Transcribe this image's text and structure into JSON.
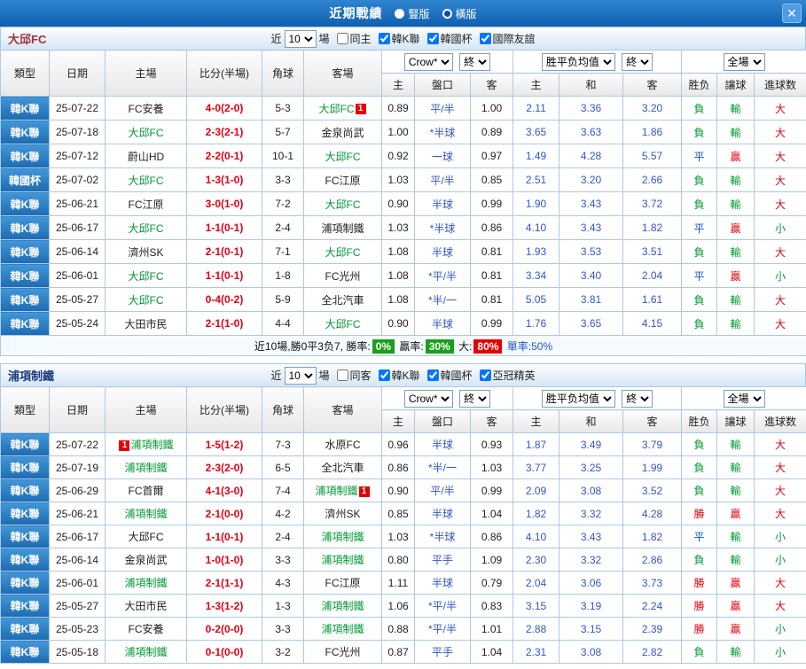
{
  "topbar": {
    "title": "近期戰績",
    "view_options": [
      {
        "label": "豎版",
        "selected": false
      },
      {
        "label": "橫版",
        "selected": true
      }
    ],
    "close": "✕"
  },
  "colors": {
    "win": "#e60012",
    "lose": "#009933",
    "draw": "#0657d0",
    "score": "#e60012",
    "team_focus": "#009933",
    "line_blue": "#3355cc",
    "badge_green": "#18a018",
    "badge_red": "#e60000"
  },
  "table_columns": {
    "left": [
      "類型",
      "日期",
      "主場",
      "比分(半場)",
      "角球",
      "客場"
    ],
    "odds_sub": [
      "主",
      "盤口",
      "客"
    ],
    "europe_sub": [
      "主",
      "和",
      "客"
    ],
    "result_sub": [
      "胜负",
      "讓球",
      "進球数"
    ]
  },
  "sections": [
    {
      "team": "大邱FC",
      "team_color": "#a03535",
      "filters": {
        "prefix": "近",
        "count": "10",
        "suffix": "場",
        "checkboxes": [
          {
            "label": "同主",
            "checked": false
          },
          {
            "label": "韓K聯",
            "checked": true
          },
          {
            "label": "韓國杯",
            "checked": true
          },
          {
            "label": "國際友誼",
            "checked": true
          }
        ]
      },
      "dropdowns": {
        "source": "Crow*",
        "source_time": "終",
        "europe": "胜平负均值",
        "europe_time": "終",
        "scope": "全場"
      },
      "rows": [
        {
          "lg": "韓K聯",
          "dt": "25-07-22",
          "h": "FC安養",
          "a": "大邱FC",
          "af": true,
          "aba": "1",
          "sc": "4-0(2-0)",
          "cn": "5-3",
          "o1": "0.89",
          "ln": "平/半",
          "o2": "1.00",
          "e1": "2.11",
          "e2": "3.36",
          "e3": "3.20",
          "rs": "負",
          "rsc": "l",
          "hd": "輸",
          "hdc": "l",
          "ou": "大",
          "ouc": "w"
        },
        {
          "lg": "韓K聯",
          "dt": "25-07-18",
          "h": "大邱FC",
          "hf": true,
          "a": "金泉尚武",
          "sc": "2-3(2-1)",
          "cn": "5-7",
          "o1": "1.00",
          "ln": "*半球",
          "o2": "0.89",
          "e1": "3.65",
          "e2": "3.63",
          "e3": "1.86",
          "rs": "負",
          "rsc": "l",
          "hd": "輸",
          "hdc": "l",
          "ou": "大",
          "ouc": "w"
        },
        {
          "lg": "韓K聯",
          "dt": "25-07-12",
          "h": "蔚山HD",
          "a": "大邱FC",
          "af": true,
          "sc": "2-2(0-1)",
          "cn": "10-1",
          "o1": "0.92",
          "ln": "一球",
          "o2": "0.97",
          "e1": "1.49",
          "e2": "4.28",
          "e3": "5.57",
          "rs": "平",
          "rsc": "d",
          "hd": "贏",
          "hdc": "w",
          "ou": "大",
          "ouc": "w"
        },
        {
          "lg": "韓國杯",
          "dt": "25-07-02",
          "h": "大邱FC",
          "hf": true,
          "a": "FC江原",
          "sc": "1-3(1-0)",
          "cn": "3-3",
          "o1": "1.03",
          "ln": "平/半",
          "o2": "0.85",
          "e1": "2.51",
          "e2": "3.20",
          "e3": "2.66",
          "rs": "負",
          "rsc": "l",
          "hd": "輸",
          "hdc": "l",
          "ou": "大",
          "ouc": "w"
        },
        {
          "lg": "韓K聯",
          "dt": "25-06-21",
          "h": "FC江原",
          "a": "大邱FC",
          "af": true,
          "sc": "3-0(1-0)",
          "cn": "7-2",
          "o1": "0.90",
          "ln": "半球",
          "o2": "0.99",
          "e1": "1.90",
          "e2": "3.43",
          "e3": "3.72",
          "rs": "負",
          "rsc": "l",
          "hd": "輸",
          "hdc": "l",
          "ou": "大",
          "ouc": "w"
        },
        {
          "lg": "韓K聯",
          "dt": "25-06-17",
          "h": "大邱FC",
          "hf": true,
          "a": "浦項制鐵",
          "sc": "1-1(0-1)",
          "cn": "2-4",
          "o1": "1.03",
          "ln": "*半球",
          "o2": "0.86",
          "e1": "4.10",
          "e2": "3.43",
          "e3": "1.82",
          "rs": "平",
          "rsc": "d",
          "hd": "贏",
          "hdc": "w",
          "ou": "小",
          "ouc": "l"
        },
        {
          "lg": "韓K聯",
          "dt": "25-06-14",
          "h": "濟州SK",
          "a": "大邱FC",
          "af": true,
          "sc": "2-1(0-1)",
          "cn": "7-1",
          "o1": "1.08",
          "ln": "半球",
          "o2": "0.81",
          "e1": "1.93",
          "e2": "3.53",
          "e3": "3.51",
          "rs": "負",
          "rsc": "l",
          "hd": "輸",
          "hdc": "l",
          "ou": "大",
          "ouc": "w"
        },
        {
          "lg": "韓K聯",
          "dt": "25-06-01",
          "h": "大邱FC",
          "hf": true,
          "a": "FC光州",
          "sc": "1-1(0-1)",
          "cn": "1-8",
          "o1": "1.08",
          "ln": "*平/半",
          "o2": "0.81",
          "e1": "3.34",
          "e2": "3.40",
          "e3": "2.04",
          "rs": "平",
          "rsc": "d",
          "hd": "贏",
          "hdc": "w",
          "ou": "小",
          "ouc": "l"
        },
        {
          "lg": "韓K聯",
          "dt": "25-05-27",
          "h": "大邱FC",
          "hf": true,
          "a": "全北汽車",
          "sc": "0-4(0-2)",
          "cn": "5-9",
          "o1": "1.08",
          "ln": "*半/一",
          "o2": "0.81",
          "e1": "5.05",
          "e2": "3.81",
          "e3": "1.61",
          "rs": "負",
          "rsc": "l",
          "hd": "輸",
          "hdc": "l",
          "ou": "大",
          "ouc": "w"
        },
        {
          "lg": "韓K聯",
          "dt": "25-05-24",
          "h": "大田市民",
          "a": "大邱FC",
          "af": true,
          "sc": "2-1(1-0)",
          "cn": "4-4",
          "o1": "0.90",
          "ln": "半球",
          "o2": "0.99",
          "e1": "1.76",
          "e2": "3.65",
          "e3": "4.15",
          "rs": "負",
          "rsc": "l",
          "hd": "輸",
          "hdc": "l",
          "ou": "大",
          "ouc": "w"
        }
      ],
      "summary": {
        "lead": "近10場,勝0平3负7,",
        "items": [
          {
            "label": "勝率:",
            "value": "0%",
            "bg": "#18a018"
          },
          {
            "label": "贏率:",
            "value": "30%",
            "bg": "#18a018"
          },
          {
            "label": "大:",
            "value": "80%",
            "bg": "#e60000"
          }
        ],
        "tail": "單率:50%"
      }
    },
    {
      "team": "浦項制鐵",
      "team_color": "#1a3a7a",
      "filters": {
        "prefix": "近",
        "count": "10",
        "suffix": "場",
        "checkboxes": [
          {
            "label": "同客",
            "checked": false
          },
          {
            "label": "韓K聯",
            "checked": true
          },
          {
            "label": "韓國杯",
            "checked": true
          },
          {
            "label": "亞冠精英",
            "checked": true
          }
        ]
      },
      "dropdowns": {
        "source": "Crow*",
        "source_time": "終",
        "europe": "胜平负均值",
        "europe_time": "終",
        "scope": "全場"
      },
      "rows": [
        {
          "lg": "韓K聯",
          "dt": "25-07-22",
          "h": "浦項制鐵",
          "hf": true,
          "hbp": "1",
          "a": "水原FC",
          "sc": "1-5(1-2)",
          "cn": "7-3",
          "o1": "0.96",
          "ln": "半球",
          "o2": "0.93",
          "e1": "1.87",
          "e2": "3.49",
          "e3": "3.79",
          "rs": "負",
          "rsc": "l",
          "hd": "輸",
          "hdc": "l",
          "ou": "大",
          "ouc": "w"
        },
        {
          "lg": "韓K聯",
          "dt": "25-07-19",
          "h": "浦項制鐵",
          "hf": true,
          "a": "全北汽車",
          "sc": "2-3(2-0)",
          "cn": "6-5",
          "o1": "0.86",
          "ln": "*半/一",
          "o2": "1.03",
          "e1": "3.77",
          "e2": "3.25",
          "e3": "1.99",
          "rs": "負",
          "rsc": "l",
          "hd": "輸",
          "hdc": "l",
          "ou": "大",
          "ouc": "w"
        },
        {
          "lg": "韓K聯",
          "dt": "25-06-29",
          "h": "FC首爾",
          "a": "浦項制鐵",
          "af": true,
          "aba": "1",
          "sc": "4-1(3-0)",
          "cn": "7-4",
          "o1": "0.90",
          "ln": "平/半",
          "o2": "0.99",
          "e1": "2.09",
          "e2": "3.08",
          "e3": "3.52",
          "rs": "負",
          "rsc": "l",
          "hd": "輸",
          "hdc": "l",
          "ou": "大",
          "ouc": "w"
        },
        {
          "lg": "韓K聯",
          "dt": "25-06-21",
          "h": "浦項制鐵",
          "hf": true,
          "a": "濟州SK",
          "sc": "2-1(0-0)",
          "cn": "4-2",
          "o1": "0.85",
          "ln": "半球",
          "o2": "1.04",
          "e1": "1.82",
          "e2": "3.32",
          "e3": "4.28",
          "rs": "勝",
          "rsc": "w",
          "hd": "贏",
          "hdc": "w",
          "ou": "大",
          "ouc": "w"
        },
        {
          "lg": "韓K聯",
          "dt": "25-06-17",
          "h": "大邱FC",
          "a": "浦項制鐵",
          "af": true,
          "sc": "1-1(0-1)",
          "cn": "2-4",
          "o1": "1.03",
          "ln": "*半球",
          "o2": "0.86",
          "e1": "4.10",
          "e2": "3.43",
          "e3": "1.82",
          "rs": "平",
          "rsc": "d",
          "hd": "輸",
          "hdc": "l",
          "ou": "小",
          "ouc": "l"
        },
        {
          "lg": "韓K聯",
          "dt": "25-06-14",
          "h": "金泉尚武",
          "a": "浦項制鐵",
          "af": true,
          "sc": "1-0(1-0)",
          "cn": "3-3",
          "o1": "0.80",
          "ln": "平手",
          "o2": "1.09",
          "e1": "2.30",
          "e2": "3.32",
          "e3": "2.86",
          "rs": "負",
          "rsc": "l",
          "hd": "輸",
          "hdc": "l",
          "ou": "小",
          "ouc": "l"
        },
        {
          "lg": "韓K聯",
          "dt": "25-06-01",
          "h": "浦項制鐵",
          "hf": true,
          "a": "FC江原",
          "sc": "2-1(1-1)",
          "cn": "4-3",
          "o1": "1.11",
          "ln": "半球",
          "o2": "0.79",
          "e1": "2.04",
          "e2": "3.06",
          "e3": "3.73",
          "rs": "勝",
          "rsc": "w",
          "hd": "贏",
          "hdc": "w",
          "ou": "大",
          "ouc": "w"
        },
        {
          "lg": "韓K聯",
          "dt": "25-05-27",
          "h": "大田市民",
          "a": "浦項制鐵",
          "af": true,
          "sc": "1-3(1-2)",
          "cn": "1-3",
          "o1": "1.06",
          "ln": "*平/半",
          "o2": "0.83",
          "e1": "3.15",
          "e2": "3.19",
          "e3": "2.24",
          "rs": "勝",
          "rsc": "w",
          "hd": "贏",
          "hdc": "w",
          "ou": "大",
          "ouc": "w"
        },
        {
          "lg": "韓K聯",
          "dt": "25-05-23",
          "h": "FC安養",
          "a": "浦項制鐵",
          "af": true,
          "sc": "0-2(0-0)",
          "cn": "3-3",
          "o1": "0.88",
          "ln": "*平/半",
          "o2": "1.01",
          "e1": "2.88",
          "e2": "3.15",
          "e3": "2.39",
          "rs": "勝",
          "rsc": "w",
          "hd": "贏",
          "hdc": "w",
          "ou": "小",
          "ouc": "l"
        },
        {
          "lg": "韓K聯",
          "dt": "25-05-18",
          "h": "浦項制鐵",
          "hf": true,
          "a": "FC光州",
          "sc": "0-1(0-0)",
          "cn": "3-2",
          "o1": "0.87",
          "ln": "平手",
          "o2": "1.04",
          "e1": "2.31",
          "e2": "3.08",
          "e3": "2.82",
          "rs": "負",
          "rsc": "l",
          "hd": "輸",
          "hdc": "l",
          "ou": "小",
          "ouc": "l"
        }
      ]
    }
  ]
}
